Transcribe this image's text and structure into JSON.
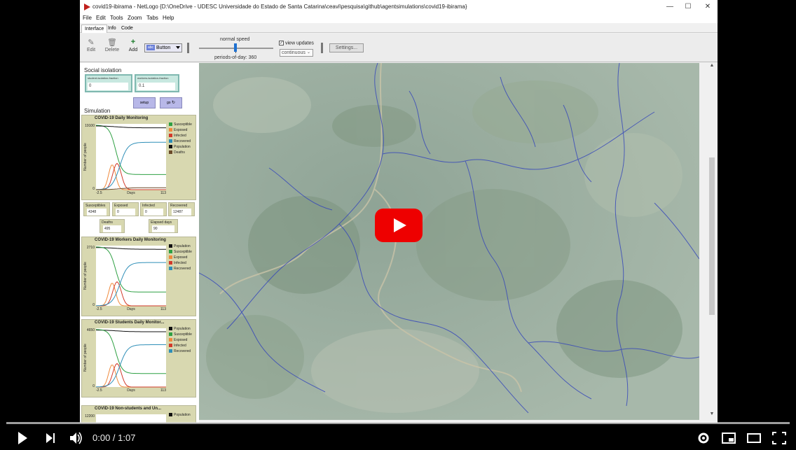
{
  "window": {
    "title": "covid19-ibirama - NetLogo {D:\\OneDrive - UDESC Universidade do Estado de Santa Catarina\\ceavi\\pesquisa\\github\\agentsimulations\\covid19-ibirama}",
    "minimize": "—",
    "maximize": "☐",
    "close": "✕"
  },
  "menu": [
    "File",
    "Edit",
    "Tools",
    "Zoom",
    "Tabs",
    "Help"
  ],
  "tabs": [
    "Interface",
    "Info",
    "Code"
  ],
  "toolbar": {
    "edit": "Edit",
    "delete": "Delete",
    "add": "Add",
    "widget_type": "Button",
    "speed_label": "normal speed",
    "periods_label": "periods-of-day: 360",
    "view_updates_label": "view updates",
    "view_updates_checked": true,
    "update_mode": "continuous",
    "settings": "Settings..."
  },
  "panel": {
    "social_isolation_title": "Social isolation",
    "student_iso_label": "student-isolation-fraction",
    "student_iso_value": "0",
    "workers_iso_label": "workers-isolation-fraction",
    "workers_iso_value": "0.1",
    "setup_label": "setup",
    "go_label": "go",
    "simulation_title": "Simulation"
  },
  "plots": [
    {
      "title": "COVID-19 Daily Monitoring",
      "ymax": "19100",
      "ymin": "0",
      "xmin": "-2.5",
      "xmax": "113",
      "xlabel": "Days",
      "ylabel": "Number of people",
      "legend": [
        {
          "name": "Susceptible",
          "color": "#2ea043"
        },
        {
          "name": "Exposed",
          "color": "#f08a3c"
        },
        {
          "name": "Infected",
          "color": "#d23a2a"
        },
        {
          "name": "Recovered",
          "color": "#2f8fb8"
        },
        {
          "name": "Population",
          "color": "#111111"
        },
        {
          "name": "Deaths",
          "color": "#6b4a2a"
        }
      ]
    },
    {
      "title": "COVID-19 Workers Daily Monitoring",
      "ymax": "2710",
      "ymin": "0",
      "xmin": "-2.5",
      "xmax": "113",
      "xlabel": "Days",
      "ylabel": "Number of people",
      "legend": [
        {
          "name": "Population",
          "color": "#111111"
        },
        {
          "name": "Susceptible",
          "color": "#2ea043"
        },
        {
          "name": "Exposed",
          "color": "#f08a3c"
        },
        {
          "name": "Infected",
          "color": "#d23a2a"
        },
        {
          "name": "Recovered",
          "color": "#2f8fb8"
        }
      ]
    },
    {
      "title": "COVID-19 Students Daily Monitor...",
      "ymax": "4650",
      "ymin": "0",
      "xmin": "-2.5",
      "xmax": "113",
      "xlabel": "Days",
      "ylabel": "Number of people",
      "legend": [
        {
          "name": "Population",
          "color": "#111111"
        },
        {
          "name": "Susceptible",
          "color": "#2ea043"
        },
        {
          "name": "Exposed",
          "color": "#f08a3c"
        },
        {
          "name": "Infected",
          "color": "#d23a2a"
        },
        {
          "name": "Recovered",
          "color": "#2f8fb8"
        }
      ]
    },
    {
      "title": "COVID-19 Non-students and Un...",
      "ymax": "12200",
      "legend": [
        {
          "name": "Population",
          "color": "#111111"
        }
      ]
    }
  ],
  "monitors": [
    {
      "label": "Susceptibles",
      "value": "4348"
    },
    {
      "label": "Exposed",
      "value": "0"
    },
    {
      "label": "Infected",
      "value": "0"
    },
    {
      "label": "Recovered",
      "value": "12487"
    },
    {
      "label": "Deaths",
      "value": "495"
    },
    {
      "label": "Elapsed days",
      "value": "90"
    }
  ],
  "player": {
    "time": "0:00 / 1:07",
    "play_icon": "play-icon",
    "next_icon": "next-icon",
    "volume_icon": "volume-icon",
    "settings_icon": "gear-icon",
    "miniplayer_icon": "miniplayer-icon",
    "theater_icon": "theater-icon",
    "fullscreen_icon": "fullscreen-icon",
    "accent": "#ff0000"
  }
}
